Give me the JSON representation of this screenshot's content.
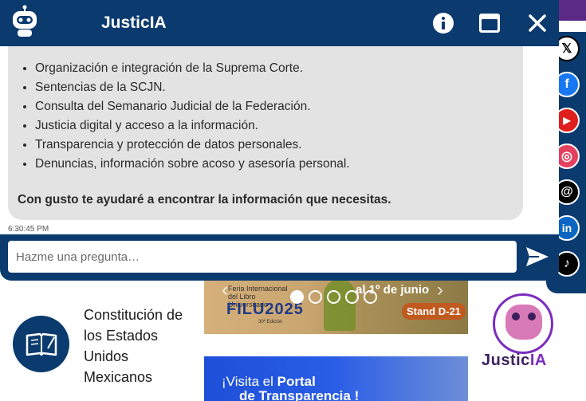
{
  "chat": {
    "title": "JusticIA",
    "icons": {
      "avatar": "robot-icon",
      "info": "info-icon",
      "minimize": "minimize-icon",
      "close": "close-icon",
      "send": "send-icon"
    },
    "message": {
      "items": [
        "Organización e integración de la Suprema Corte.",
        "Sentencias de la SCJN.",
        "Consulta del Semanario Judicial de la Federación.",
        "Justicia digital y acceso a la información.",
        "Transparencia y protección de datos personales.",
        "Denuncias, información sobre acoso y asesoría personal."
      ],
      "closing": "Con gusto te ayudaré a encontrar la información que necesitas.",
      "timestamp": "6:30:45 PM"
    },
    "input": {
      "placeholder": "Hazme una pregunta…",
      "value": ""
    }
  },
  "social": [
    {
      "name": "x",
      "glyph": "𝕏"
    },
    {
      "name": "facebook",
      "glyph": "f"
    },
    {
      "name": "youtube",
      "glyph": "▶"
    },
    {
      "name": "instagram",
      "glyph": "◎"
    },
    {
      "name": "threads",
      "glyph": "@"
    },
    {
      "name": "linkedin",
      "glyph": "in"
    },
    {
      "name": "tiktok",
      "glyph": "♪"
    }
  ],
  "constitucion": {
    "label": "Constitución de los Estados Unidos Mexicanos",
    "icon": "book-icon"
  },
  "banner1": {
    "small_text": "Feria Internacional del Libro Universitario",
    "brand": "FILU2025",
    "edition": "30ª Edición",
    "date": "al 1º de junio",
    "stand": "Stand D-21",
    "slide_count": 5,
    "active_slide": 1
  },
  "banner2": {
    "line1_pre": "¡Visita el ",
    "line1_bold": "Portal",
    "line2": "de Transparencia !"
  },
  "justicia_logo": {
    "text_main": "Justic",
    "text_accent": "IA"
  },
  "colors": {
    "navy": "#0b3a6e",
    "bubble": "#e3e3e3",
    "purple": "#7b2cbf"
  }
}
